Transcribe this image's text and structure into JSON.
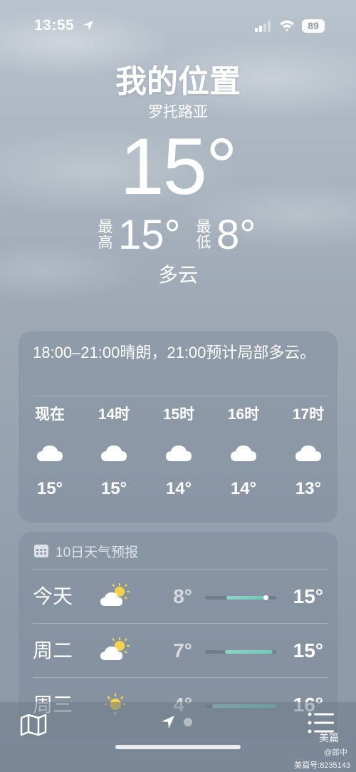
{
  "status": {
    "time": "13:55",
    "battery": "89"
  },
  "header": {
    "title": "我的位置",
    "subtitle": "罗托路亚",
    "temperature": "15°",
    "high_label_top": "最",
    "high_label_bottom": "高",
    "high_value": "15°",
    "low_label_top": "最",
    "low_label_bottom": "低",
    "low_value": "8°",
    "condition": "多云"
  },
  "hourly": {
    "summary": "18:00–21:00晴朗，21:00预计局部多云。",
    "items": [
      {
        "label": "现在",
        "icon": "cloud-icon",
        "temp": "15°"
      },
      {
        "label": "14时",
        "icon": "cloud-icon",
        "temp": "15°"
      },
      {
        "label": "15时",
        "icon": "cloud-icon",
        "temp": "14°"
      },
      {
        "label": "16时",
        "icon": "cloud-icon",
        "temp": "14°"
      },
      {
        "label": "17时",
        "icon": "cloud-icon",
        "temp": "13°"
      }
    ]
  },
  "daily": {
    "header": "10日天气预报",
    "days": [
      {
        "name": "今天",
        "icon": "partly-sunny-icon",
        "low": "8°",
        "high": "15°",
        "range_start": 0.3,
        "range_end": 0.85,
        "current_marker": 0.85
      },
      {
        "name": "周二",
        "icon": "partly-sunny-icon",
        "low": "7°",
        "high": "15°",
        "range_start": 0.28,
        "range_end": 0.95
      },
      {
        "name": "周三",
        "icon": "sun-icon",
        "low": "4°",
        "high": "16°",
        "range_start": 0.1,
        "range_end": 1.0
      }
    ]
  },
  "watermark": {
    "logo": "美篇",
    "user": "@郎中",
    "id": "美篇号:8235143"
  },
  "colors": {
    "bar_fill": "#6ec8b5",
    "background": "#9ea9b5"
  }
}
